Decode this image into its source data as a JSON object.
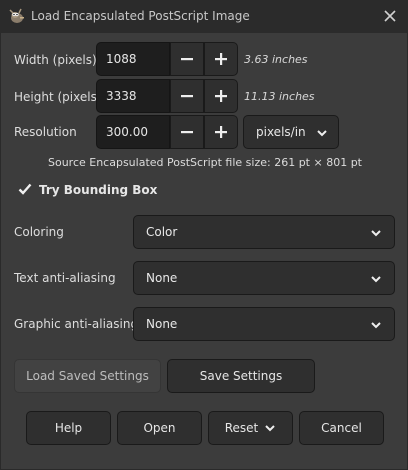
{
  "window": {
    "title": "Load Encapsulated PostScript Image",
    "app_icon": "gimp-wilber-icon",
    "close_icon": "close-icon"
  },
  "width": {
    "label": "Width (pixels)",
    "value": "1088",
    "hint": "3.63 inches"
  },
  "height": {
    "label": "Height (pixels)",
    "value": "3338",
    "hint": "11.13 inches"
  },
  "resolution": {
    "label": "Resolution",
    "value": "300.00",
    "unit": "pixels/in"
  },
  "source_info": "Source Encapsulated PostScript file size: 261 pt × 801 pt",
  "bounding_box": {
    "label": "Try Bounding Box",
    "checked": true
  },
  "coloring": {
    "label": "Coloring",
    "value": "Color"
  },
  "text_aa": {
    "label": "Text anti-aliasing",
    "value": "None"
  },
  "graphic_aa": {
    "label": "Graphic anti-aliasing",
    "value": "None"
  },
  "settings_buttons": {
    "load": "Load Saved Settings",
    "save": "Save Settings"
  },
  "dialog_buttons": {
    "help": "Help",
    "open": "Open",
    "reset": "Reset",
    "cancel": "Cancel"
  },
  "colors": {
    "background": "#3c3c3c",
    "titlebar": "#2b2b2b",
    "entry": "#1e1e1e",
    "button": "#2f2f2f"
  }
}
